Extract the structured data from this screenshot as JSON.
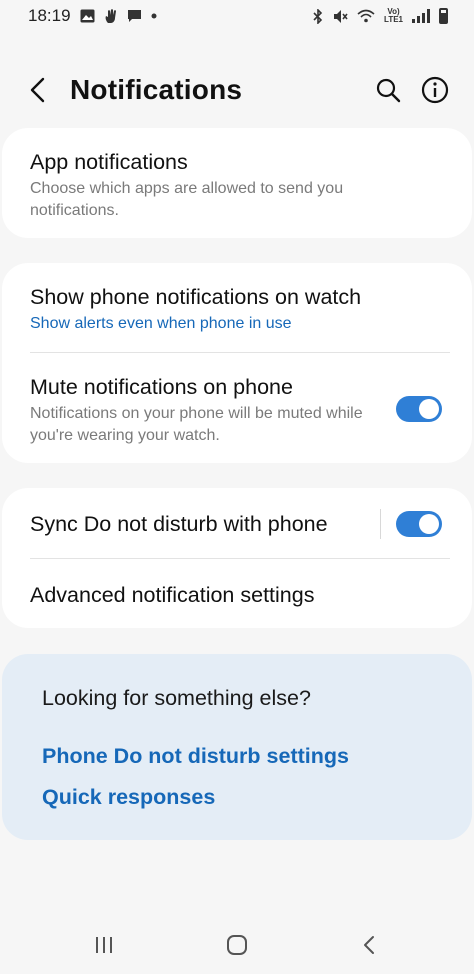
{
  "status_bar": {
    "time": "18:19",
    "left_icons": [
      "gallery-icon",
      "hand-icon",
      "message-icon",
      "dot-icon"
    ],
    "right_icons": [
      "bluetooth-icon",
      "mute-icon",
      "wifi-icon",
      "volte-icon",
      "signal-icon",
      "battery-icon"
    ],
    "volte_label": "Vo)\nLTE1"
  },
  "header": {
    "title": "Notifications"
  },
  "app_notifications": {
    "title": "App notifications",
    "subtitle": "Choose which apps are allowed to send you notifications."
  },
  "watch_section": {
    "show_on_watch": {
      "title": "Show phone notifications on watch",
      "subtitle": "Show alerts even when phone in use"
    },
    "mute_on_phone": {
      "title": "Mute notifications on phone",
      "subtitle": "Notifications on your phone will be muted while you're wearing your watch.",
      "enabled": true
    }
  },
  "dnd_section": {
    "sync_dnd": {
      "title": "Sync Do not disturb with phone",
      "enabled": true
    },
    "advanced": {
      "title": "Advanced notification settings"
    }
  },
  "suggestions": {
    "heading": "Looking for something else?",
    "links": [
      "Phone Do not disturb settings",
      "Quick responses"
    ]
  },
  "colors": {
    "accent": "#2f7fd6",
    "link": "#1668b8",
    "background": "#f6f6f6",
    "card": "#ffffff",
    "suggest_background": "#e4edf6"
  }
}
